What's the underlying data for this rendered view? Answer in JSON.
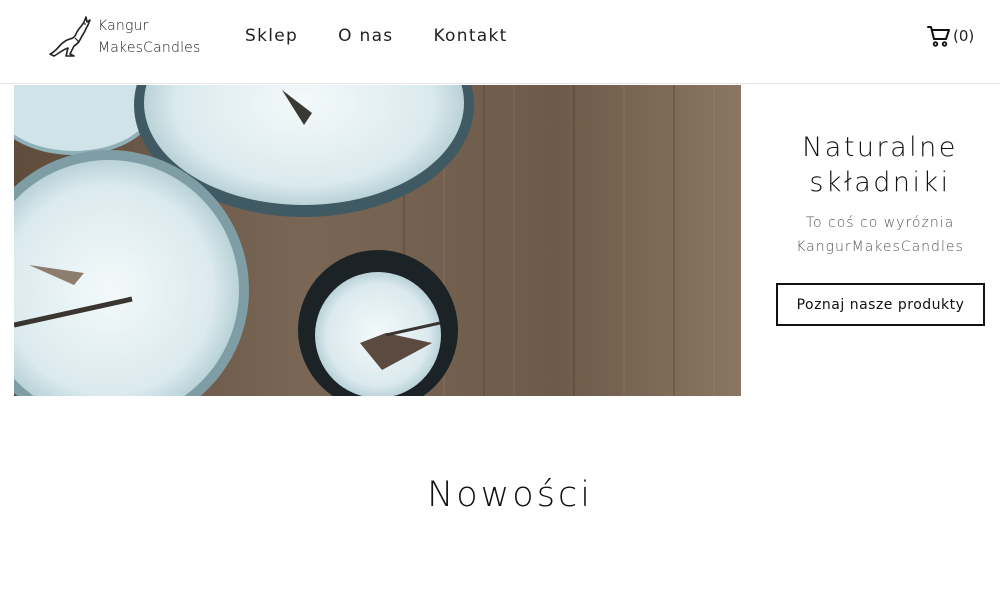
{
  "brand": {
    "line1": "Kangur",
    "line2": "MakesCandles",
    "icon": "kangaroo-icon"
  },
  "nav": {
    "items": [
      {
        "label": "Sklep"
      },
      {
        "label": "O nas"
      },
      {
        "label": "Kontakt"
      }
    ]
  },
  "cart": {
    "icon": "shopping-cart-icon",
    "count_text": "(0)"
  },
  "hero": {
    "title_line1": "Naturalne",
    "title_line2": "składniki",
    "subtitle_line1": "To coś co wyróżnia",
    "subtitle_line2": "KangurMakesCandles",
    "button_label": "Poznaj nasze produkty"
  },
  "section": {
    "title": "Nowości"
  },
  "colors": {
    "text": "#111111",
    "wood": "#6b5a48",
    "candle_wax": "#e4f0f2",
    "jar_dark": "#1f2a2e",
    "border": "#e6e6e6"
  }
}
